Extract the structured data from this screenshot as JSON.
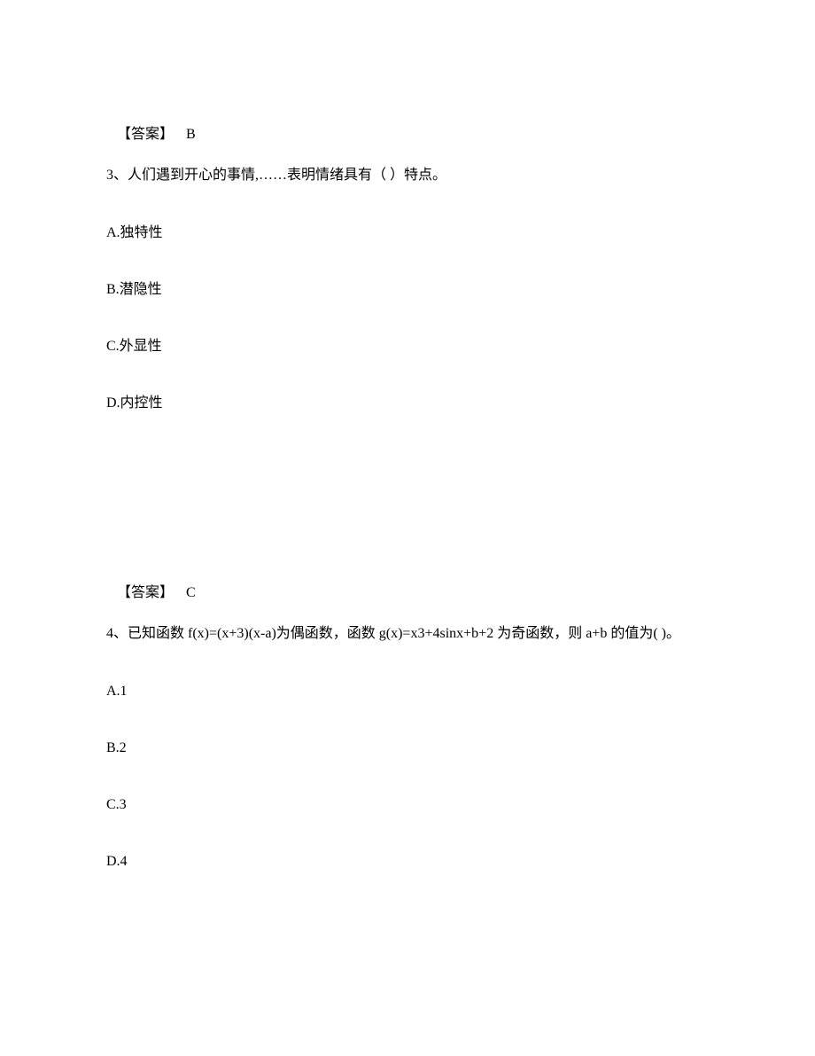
{
  "q2": {
    "answer_label": "【答案】",
    "answer_value": "B"
  },
  "q3": {
    "question_text": "3、人们遇到开心的事情,……表明情绪具有（ ）特点。",
    "options": {
      "A": "A.独特性",
      "B": "B.潜隐性",
      "C": "C.外显性",
      "D": "D.内控性"
    },
    "answer_label": "【答案】",
    "answer_value": "C"
  },
  "q4": {
    "question_text": "4、已知函数 f(x)=(x+3)(x-a)为偶函数，函数 g(x)=x3+4sinx+b+2 为奇函数，则 a+b 的值为(   )。",
    "options": {
      "A": "A.1",
      "B": "B.2",
      "C": "C.3",
      "D": "D.4"
    }
  }
}
